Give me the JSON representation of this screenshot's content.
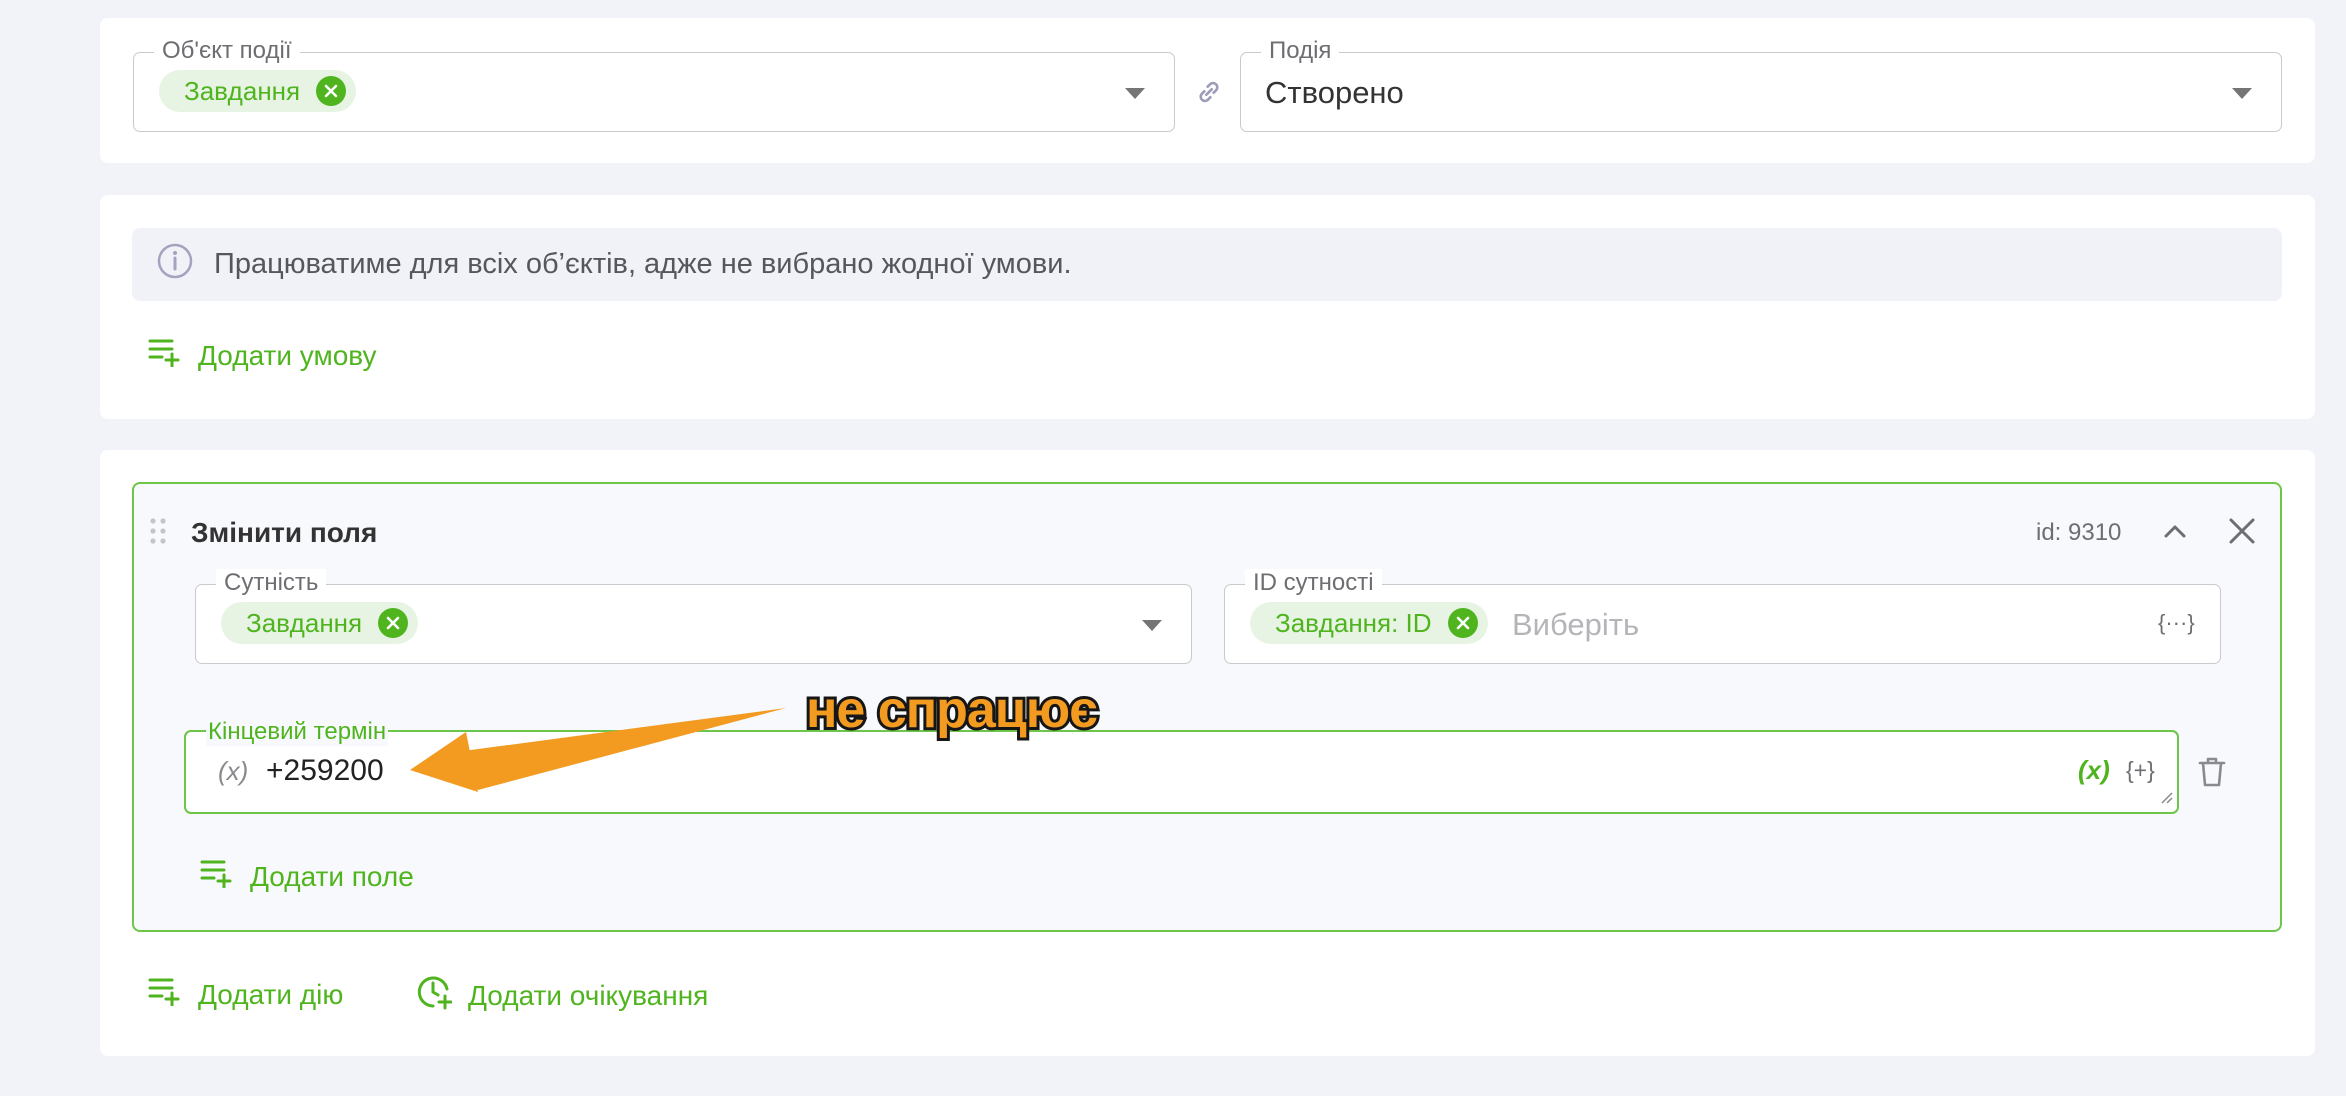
{
  "trigger": {
    "object_label": "Об'єкт події",
    "object_chip": "Завдання",
    "event_label": "Подія",
    "event_value": "Створено"
  },
  "conditions": {
    "info_text": "Працюватиме для всіх об’єктів, адже не вибрано жодної умови.",
    "add_condition": "Додати умову"
  },
  "action": {
    "title": "Змінити поля",
    "id_text": "id: 9310",
    "entity_label": "Сутність",
    "entity_chip": "Завдання",
    "entity_id_label": "ID сутності",
    "entity_id_chip": "Завдання: ID",
    "entity_id_placeholder": "Виберіть",
    "braces_dots": "{···}",
    "deadline_label": "Кінцевий термін",
    "deadline_prefix": "(x)",
    "deadline_value": "+259200",
    "var_button": "(x)",
    "func_button": "{+}",
    "add_field": "Додати поле"
  },
  "footer": {
    "add_action": "Додати дію",
    "add_wait": "Додати очікування"
  },
  "annotation": {
    "text": "не спрацює"
  },
  "colors": {
    "accent_green": "#4fb41e",
    "chip_bg": "#e7f4e3",
    "annotation_orange": "#f39a21",
    "page_bg": "#f2f3f8"
  }
}
